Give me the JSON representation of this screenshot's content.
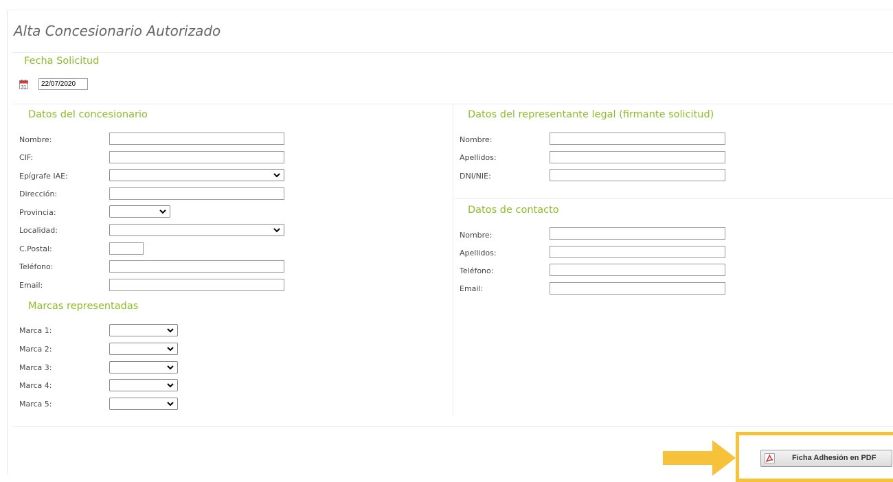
{
  "page": {
    "title": "Alta Concesionario Autorizado"
  },
  "fecha": {
    "section_title": "Fecha Solicitud",
    "value": "22/07/2020",
    "icon": "calendar-icon"
  },
  "concesionario": {
    "section_title": "Datos del concesionario",
    "fields": {
      "nombre": "Nombre:",
      "cif": "CIF:",
      "epigrafe": "Epígrafe IAE:",
      "direccion": "Dirección:",
      "provincia": "Provincia:",
      "localidad": "Localidad:",
      "cpostal": "C.Postal:",
      "telefono": "Teléfono:",
      "email": "Email:"
    }
  },
  "marcas": {
    "section_title": "Marcas representadas",
    "labels": [
      "Marca 1:",
      "Marca 2:",
      "Marca 3:",
      "Marca 4:",
      "Marca 5:"
    ]
  },
  "representante": {
    "section_title": "Datos del representante legal (firmante solicitud)",
    "fields": {
      "nombre": "Nombre:",
      "apellidos": "Apellidos:",
      "dni": "DNI/NIE:"
    }
  },
  "contacto": {
    "section_title": "Datos de contacto",
    "fields": {
      "nombre": "Nombre:",
      "apellidos": "Apellidos:",
      "telefono": "Teléfono:",
      "email": "Email:"
    }
  },
  "actions": {
    "pdf_label": "Ficha Adhesión en PDF",
    "pdf_icon": "pdf-icon",
    "highlight_color": "#f7c23a"
  },
  "colors": {
    "section_title": "#8cbf26",
    "highlight": "#f7c23a"
  }
}
